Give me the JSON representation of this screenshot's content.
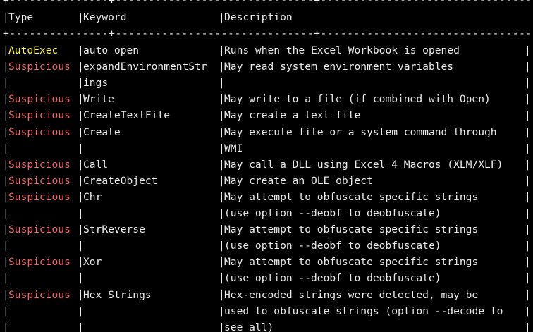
{
  "colors": {
    "background": "#000000",
    "text": "#e9e9e9",
    "autoexec": "#f6f24a",
    "suspicious": "#f06464"
  },
  "separator": "|",
  "borders": {
    "top": "+---------------+------------------------------+------------------------------------------------------------+",
    "header_bottom": "+---------------+------------------------------+------------------------------------------------------------+"
  },
  "table": {
    "headers": {
      "type": "Type",
      "keyword": "Keyword",
      "description": "Description"
    },
    "rows": [
      {
        "type": "AutoExec",
        "kind": "autoexec",
        "keyword": "auto_open",
        "description": "Runs when the Excel Workbook is opened"
      },
      {
        "type": "Suspicious",
        "kind": "suspicious",
        "keyword": "expandEnvironmentStr",
        "description": "May read system environment variables"
      },
      {
        "type": "",
        "kind": "",
        "keyword": "ings",
        "description": ""
      },
      {
        "type": "Suspicious",
        "kind": "suspicious",
        "keyword": "Write",
        "description": "May write to a file (if combined with Open)"
      },
      {
        "type": "Suspicious",
        "kind": "suspicious",
        "keyword": "CreateTextFile",
        "description": "May create a text file"
      },
      {
        "type": "Suspicious",
        "kind": "suspicious",
        "keyword": "Create",
        "description": "May execute file or a system command through"
      },
      {
        "type": "",
        "kind": "",
        "keyword": "",
        "description": "WMI"
      },
      {
        "type": "Suspicious",
        "kind": "suspicious",
        "keyword": "Call",
        "description": "May call a DLL using Excel 4 Macros (XLM/XLF)"
      },
      {
        "type": "Suspicious",
        "kind": "suspicious",
        "keyword": "CreateObject",
        "description": "May create an OLE object"
      },
      {
        "type": "Suspicious",
        "kind": "suspicious",
        "keyword": "Chr",
        "description": "May attempt to obfuscate specific strings"
      },
      {
        "type": "",
        "kind": "",
        "keyword": "",
        "description": "(use option --deobf to deobfuscate)"
      },
      {
        "type": "Suspicious",
        "kind": "suspicious",
        "keyword": "StrReverse",
        "description": "May attempt to obfuscate specific strings"
      },
      {
        "type": "",
        "kind": "",
        "keyword": "",
        "description": "(use option --deobf to deobfuscate)"
      },
      {
        "type": "Suspicious",
        "kind": "suspicious",
        "keyword": "Xor",
        "description": "May attempt to obfuscate specific strings"
      },
      {
        "type": "",
        "kind": "",
        "keyword": "",
        "description": "(use option --deobf to deobfuscate)"
      },
      {
        "type": "Suspicious",
        "kind": "suspicious",
        "keyword": "Hex Strings",
        "description": "Hex-encoded strings were detected, may be"
      },
      {
        "type": "",
        "kind": "",
        "keyword": "",
        "description": "used to obfuscate strings (option --decode to"
      },
      {
        "type": "",
        "kind": "",
        "keyword": "",
        "description": "see all)"
      }
    ]
  }
}
